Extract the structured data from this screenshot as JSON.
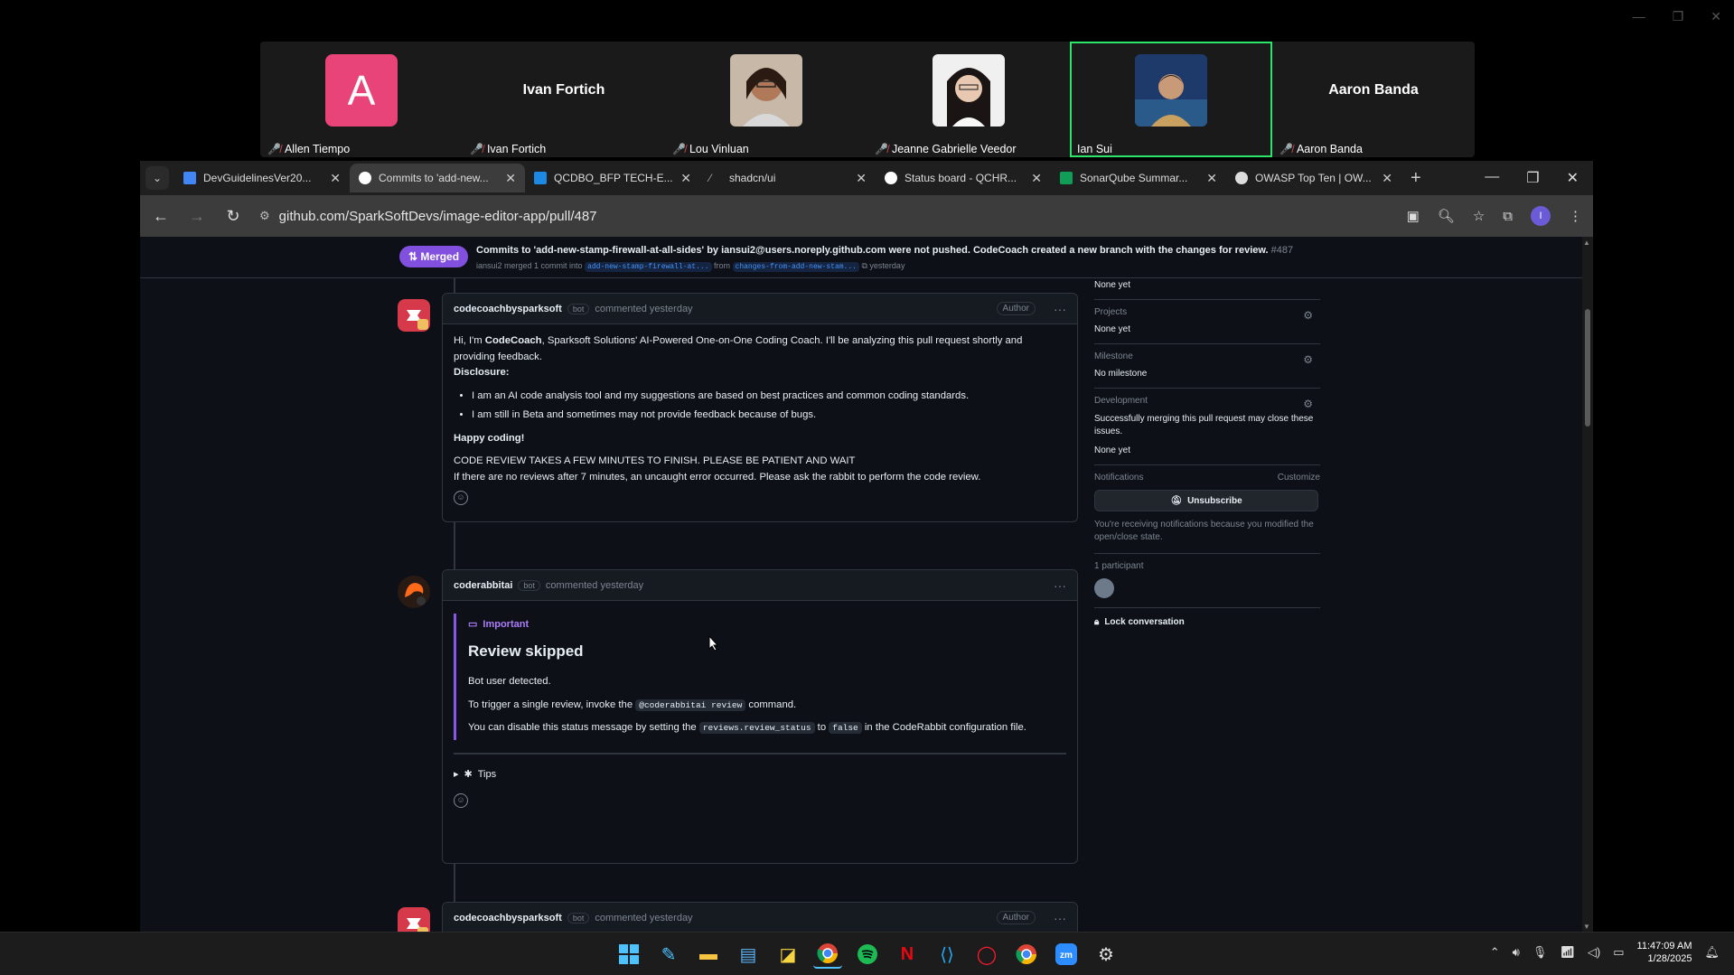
{
  "participants": [
    {
      "name": "Allen Tiempo",
      "avatar_letter": "A",
      "big_name": ""
    },
    {
      "name": "Ivan Fortich",
      "avatar_letter": "",
      "big_name": "Ivan Fortich"
    },
    {
      "name": "Lou Vinluan",
      "avatar_letter": "",
      "big_name": ""
    },
    {
      "name": "Jeanne Gabrielle Veedor",
      "avatar_letter": "",
      "big_name": ""
    },
    {
      "name": "Ian Sui",
      "avatar_letter": "",
      "big_name": ""
    },
    {
      "name": "Aaron Banda",
      "avatar_letter": "",
      "big_name": "Aaron Banda"
    }
  ],
  "tabs": [
    {
      "title": "DevGuidelinesVer20...",
      "icon": "docs-icon",
      "color": "#4285f4"
    },
    {
      "title": "Commits to 'add-new...",
      "icon": "github-icon",
      "color": "#ffffff"
    },
    {
      "title": "QCDBO_BFP TECH-E...",
      "icon": "chart-icon",
      "color": "#1e88e5"
    },
    {
      "title": "shadcn/ui",
      "icon": "shadcn-icon",
      "color": "#aaaaaa"
    },
    {
      "title": "Status board - QCHR...",
      "icon": "github-icon",
      "color": "#ffffff"
    },
    {
      "title": "SonarQube Summar...",
      "icon": "sheets-icon",
      "color": "#0f9d58"
    },
    {
      "title": "OWASP Top Ten | OW...",
      "icon": "owasp-icon",
      "color": "#dddddd"
    }
  ],
  "url": "github.com/SparkSoftDevs/image-editor-app/pull/487",
  "pr": {
    "badge": "Merged",
    "title": "Commits to 'add-new-stamp-firewall-at-all-sides' by iansui2@users.noreply.github.com were not pushed. CodeCoach created a new branch with the changes for review.",
    "number": "#487",
    "merged_by": "iansui2 merged 1 commit into",
    "base_branch": "add-new-stamp-firewall-at...",
    "from": "from",
    "head_branch": "changes-from-add-new-stam...",
    "when": "yesterday"
  },
  "comment1": {
    "author": "codecoachbysparksoft",
    "bot": "bot",
    "meta": "commented yesterday",
    "author_badge": "Author",
    "intro_start": "Hi, I'm ",
    "intro_bold": "CodeCoach",
    "intro_end": ", Sparksoft Solutions' AI-Powered One-on-One Coding Coach. I'll be analyzing this pull request shortly and providing feedback.",
    "disclosure": "Disclosure:",
    "bullets": [
      "I am an AI code analysis tool and my suggestions are based on best practices and common coding standards.",
      "I am still in Beta and sometimes may not provide feedback because of bugs."
    ],
    "happy": "Happy coding!",
    "notice": "CODE REVIEW TAKES A FEW MINUTES TO FINISH. PLEASE BE PATIENT AND WAIT",
    "notice_sub": "If there are no reviews after 7 minutes, an uncaught error occurred. Please ask the rabbit to perform the code review."
  },
  "comment2": {
    "author": "coderabbitai",
    "bot": "bot",
    "meta": "commented yesterday",
    "callout_label": "Important",
    "heading": "Review skipped",
    "line1": "Bot user detected.",
    "line2_pre": "To trigger a single review, invoke the ",
    "line2_code": "@coderabbitai review",
    "line2_post": " command.",
    "line3_pre": "You can disable this status message by setting the ",
    "line3_code1": "reviews.review_status",
    "line3_mid": " to ",
    "line3_code2": "false",
    "line3_post": " in the CodeRabbit configuration file.",
    "tips": "Tips"
  },
  "comment3": {
    "author": "codecoachbysparksoft",
    "bot": "bot",
    "meta": "commented yesterday",
    "author_badge": "Author"
  },
  "sidebar": {
    "reviewers_value": "None yet",
    "projects_title": "Projects",
    "projects_value": "None yet",
    "milestone_title": "Milestone",
    "milestone_value": "No milestone",
    "development_title": "Development",
    "development_desc": "Successfully merging this pull request may close these issues.",
    "development_value": "None yet",
    "notifications_title": "Notifications",
    "customize": "Customize",
    "unsubscribe": "Unsubscribe",
    "notif_desc": "You're receiving notifications because you modified the open/close state.",
    "participants_title": "1 participant",
    "lock": "Lock conversation"
  },
  "clock": {
    "time": "11:47:09 AM",
    "date": "1/28/2025"
  }
}
